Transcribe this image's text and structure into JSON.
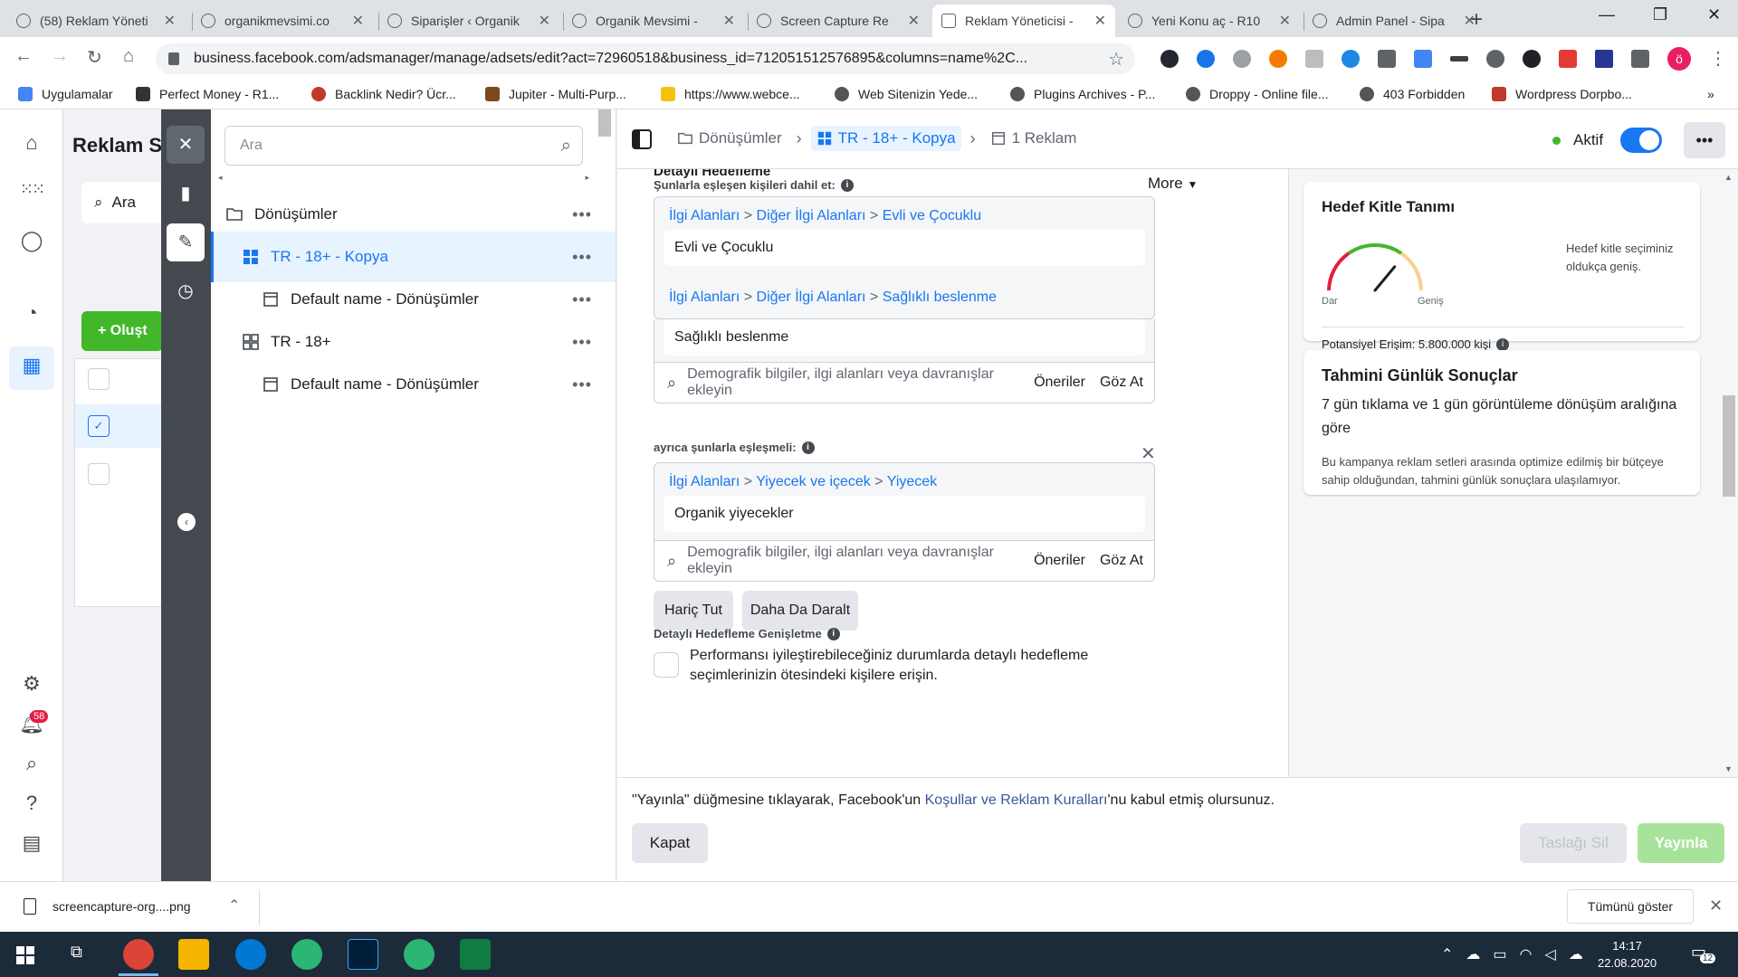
{
  "browser": {
    "tabs": [
      {
        "title": "(58) Reklam Yöneti",
        "active": false
      },
      {
        "title": "organikmevsimi.co",
        "active": false
      },
      {
        "title": "Siparişler ‹ Organik",
        "active": false
      },
      {
        "title": "Organik Mevsimi -",
        "active": false
      },
      {
        "title": "Screen Capture Re",
        "active": false
      },
      {
        "title": "Reklam Yöneticisi -",
        "active": true
      },
      {
        "title": "Yeni Konu aç - R10",
        "active": false
      },
      {
        "title": "Admin Panel - Sipa",
        "active": false
      }
    ],
    "url": "business.facebook.com/adsmanager/manage/adsets/edit?act=72960518&business_id=712051512576895&columns=name%2C...",
    "profile_initial": "ö",
    "bookmarks": [
      {
        "label": "Uygulamalar",
        "color": "#4285f4"
      },
      {
        "label": "Perfect Money - R1...",
        "color": "#333333"
      },
      {
        "label": "Backlink Nedir? Ücr...",
        "color": "#c0392b"
      },
      {
        "label": "Jupiter - Multi-Purp...",
        "color": "#7a4a1e"
      },
      {
        "label": "https://www.webce...",
        "color": "#f4c20d"
      },
      {
        "label": "Web Sitenizin Yede...",
        "color": "#555555"
      },
      {
        "label": "Plugins Archives - P...",
        "color": "#555555"
      },
      {
        "label": "Droppy - Online file...",
        "color": "#555555"
      },
      {
        "label": "403 Forbidden",
        "color": "#555555"
      },
      {
        "label": "Wordpress Dorpbo...",
        "color": "#c0392b"
      }
    ]
  },
  "background_panel": {
    "title": "Reklam S",
    "search_label": "Ara",
    "create_label": "+ Oluşt",
    "notification_count": "58"
  },
  "tree": {
    "search_placeholder": "Ara",
    "items": [
      {
        "label": "Dönüşümler",
        "level": "campaign",
        "active": false
      },
      {
        "label": "TR - 18+ - Kopya",
        "level": "adset",
        "active": true
      },
      {
        "label": "Default name - Dönüşümler",
        "level": "ad",
        "active": false
      },
      {
        "label": "TR - 18+",
        "level": "adset",
        "active": false
      },
      {
        "label": "Default name - Dönüşümler",
        "level": "ad",
        "active": false
      }
    ],
    "more_glyph": "•••"
  },
  "topbar": {
    "breadcrumb": [
      "Dönüşümler",
      "TR - 18+ - Kopya",
      "1 Reklam"
    ],
    "status_label": "Aktif",
    "more_dropdown": "More"
  },
  "form": {
    "section_title": "Detaylı Hedefleme",
    "include_label": "Şunlarla eşleşen kişileri dahil et:",
    "include_items": [
      {
        "path": [
          "İlgi Alanları",
          "Diğer İlgi Alanları",
          "Evli ve Çocuklu"
        ],
        "chip": "Evli ve Çocuklu"
      },
      {
        "path": [
          "İlgi Alanları",
          "Diğer İlgi Alanları",
          "Sağlıklı beslenme"
        ],
        "chip": "Sağlıklı beslenme"
      }
    ],
    "search_placeholder": "Demografik bilgiler, ilgi alanları veya davranışlar ekleyin",
    "suggestions_label": "Öneriler",
    "browse_label": "Göz At",
    "narrow_label": "ayrıca şunlarla eşleşmeli:",
    "narrow_items": [
      {
        "path": [
          "İlgi Alanları",
          "Yiyecek ve içecek",
          "Yiyecek"
        ],
        "chip": "Organik yiyecekler"
      }
    ],
    "exclude_button": "Hariç Tut",
    "narrow_more_button": "Daha Da Daralt",
    "expansion_label": "Detaylı Hedefleme Genişletme",
    "expansion_text": "Performansı iyileştirebileceğiniz durumlarda detaylı hedefleme seçimlerinizin ötesindeki kişilere erişin.",
    "path_separator": ">"
  },
  "audience_card": {
    "title": "Hedef Kitle Tanımı",
    "gauge_left": "Dar",
    "gauge_right": "Geniş",
    "gauge_position": 0.72,
    "description": "Hedef kitle seçiminiz oldukça geniş.",
    "reach_label": "Potansiyel Erişim: 5.800.000 kişi"
  },
  "results_card": {
    "title": "Tahmini Günlük Sonuçlar",
    "subtitle": "7 gün tıklama ve 1 gün görüntüleme dönüşüm aralığına göre",
    "description": "Bu kampanya reklam setleri arasında optimize edilmiş bir bütçeye sahip olduğundan, tahmini günlük sonuçlara ulaşılamıyor."
  },
  "footer": {
    "terms_prefix": "\"Yayınla\" düğmesine tıklayarak, Facebook'un ",
    "terms_link": "Koşullar ve Reklam Kuralları",
    "terms_suffix": "'nu kabul etmiş olursunuz.",
    "close_label": "Kapat",
    "delete_draft_label": "Taslağı Sil",
    "publish_label": "Yayınla"
  },
  "downloads": {
    "file_name": "screencapture-org....png",
    "show_all_label": "Tümünü göster"
  },
  "taskbar": {
    "time": "14:17",
    "date": "22.08.2020",
    "notification_count": "12"
  },
  "colors": {
    "fb_blue": "#1877f2",
    "green": "#42b72a",
    "taskbar": "#1c2b3a"
  }
}
